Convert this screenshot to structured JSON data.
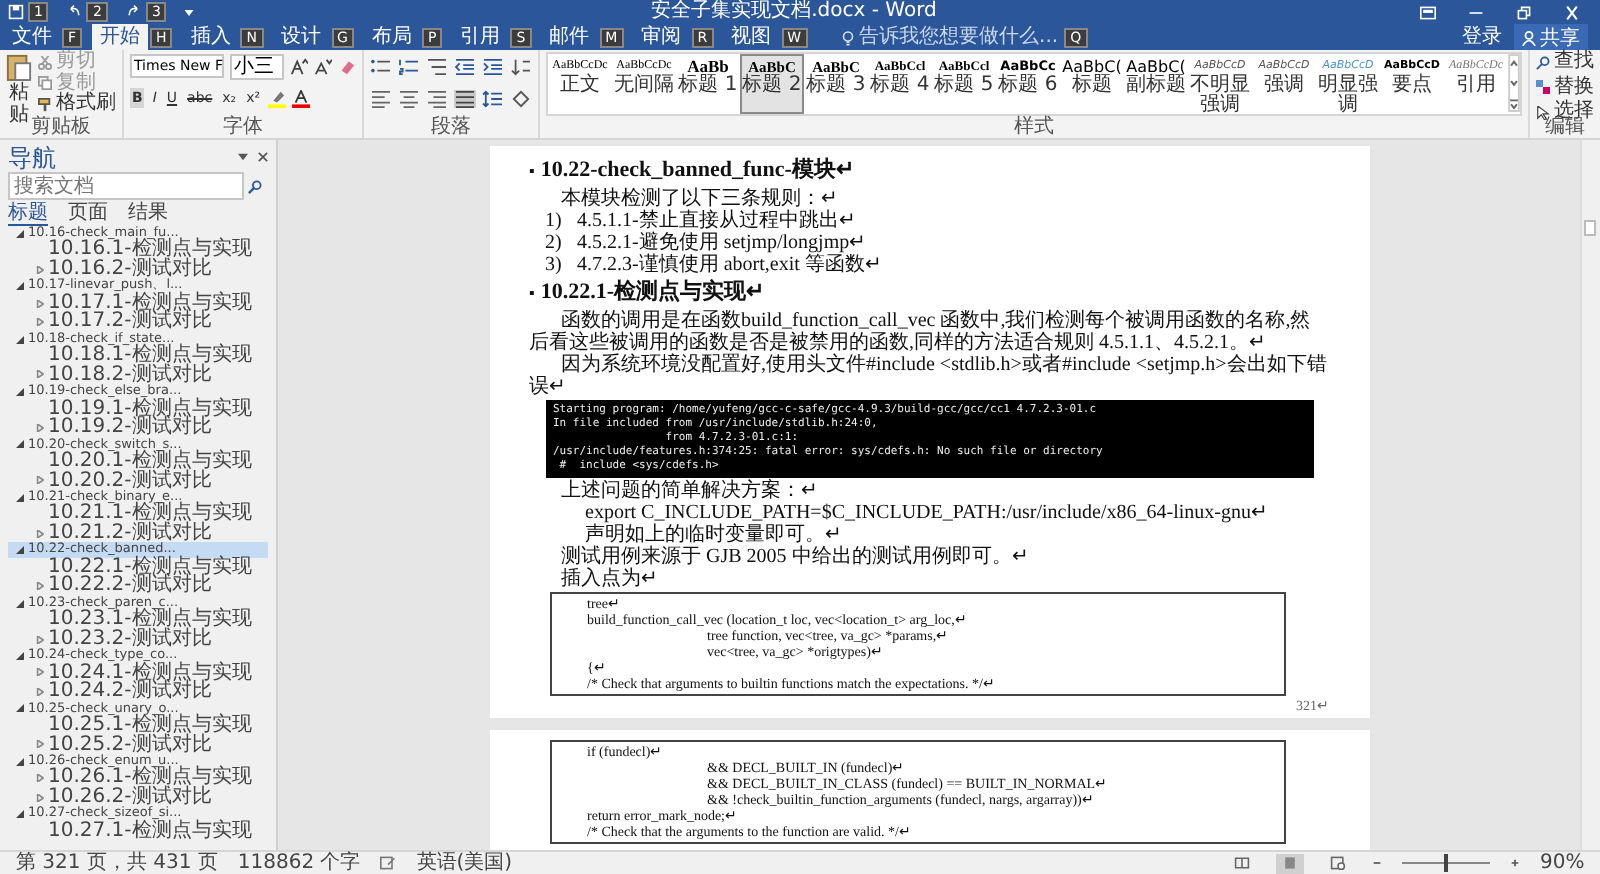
{
  "title_bar": {
    "title": "安全子集实现文档.docx - Word",
    "quick_access_keytips": [
      "1",
      "2",
      "3"
    ]
  },
  "ribbon_tabs": [
    {
      "label": "文件",
      "keytip": "F",
      "selected": false
    },
    {
      "label": "开始",
      "keytip": "H",
      "selected": true
    },
    {
      "label": "插入",
      "keytip": "N",
      "selected": false
    },
    {
      "label": "设计",
      "keytip": "G",
      "selected": false
    },
    {
      "label": "布局",
      "keytip": "P",
      "selected": false
    },
    {
      "label": "引用",
      "keytip": "S",
      "selected": false
    },
    {
      "label": "邮件",
      "keytip": "M",
      "selected": false
    },
    {
      "label": "审阅",
      "keytip": "R",
      "selected": false
    },
    {
      "label": "视图",
      "keytip": "W",
      "selected": false
    }
  ],
  "tell_me": {
    "placeholder": "告诉我您想要做什么...",
    "keytip": "Q"
  },
  "account": {
    "sign_in": "登录",
    "share": "共享"
  },
  "ribbon": {
    "clipboard": {
      "paste": "粘贴",
      "cut": "剪切",
      "copy": "复制",
      "format_painter": "格式刷",
      "label": "剪贴板"
    },
    "font": {
      "name": "Times New F",
      "size": "小三",
      "format_buttons": [
        "B",
        "I",
        "U",
        "abc",
        "x₂",
        "x²"
      ],
      "label": "字体"
    },
    "paragraph": {
      "label": "段落"
    },
    "styles": {
      "label": "样式",
      "items": [
        {
          "preview": "AaBbCcDc",
          "name": "正文",
          "selected": false
        },
        {
          "preview": "AaBbCcDc",
          "name": "无间隔",
          "selected": false
        },
        {
          "preview": "AaBb",
          "name": "标题 1",
          "selected": false
        },
        {
          "preview": "AaBbC",
          "name": "标题 2",
          "selected": true
        },
        {
          "preview": "AaBbC",
          "name": "标题 3",
          "selected": false
        },
        {
          "preview": "AaBbCcl",
          "name": "标题 4",
          "selected": false
        },
        {
          "preview": "AaBbCcl",
          "name": "标题 5",
          "selected": false
        },
        {
          "preview": "AaBbCc",
          "name": "标题 6",
          "selected": false
        },
        {
          "preview": "AaBbC(",
          "name": "标题",
          "selected": false
        },
        {
          "preview": "AaBbC(",
          "name": "副标题",
          "selected": false
        },
        {
          "preview": "AaBbCcD",
          "name": "不明显强调",
          "selected": false
        },
        {
          "preview": "AaBbCcD",
          "name": "强调",
          "selected": false
        },
        {
          "preview": "AaBbCcD",
          "name": "明显强调",
          "selected": false
        },
        {
          "preview": "AaBbCcD",
          "name": "要点",
          "selected": false
        },
        {
          "preview": "AaBbCcDc",
          "name": "引用",
          "selected": false
        }
      ]
    },
    "editing": {
      "find": "查找",
      "replace": "替换",
      "select": "选择",
      "label": "编辑"
    }
  },
  "navigation": {
    "title": "导航",
    "search": {
      "placeholder": "搜索文档"
    },
    "tabs": [
      {
        "label": "标题",
        "selected": true
      },
      {
        "label": "页面",
        "selected": false
      },
      {
        "label": "结果",
        "selected": false
      }
    ],
    "items": [
      {
        "label": "10.16-check_main_fu...",
        "expanded": true,
        "selected": false,
        "children": [
          {
            "label": "10.16.1-检测点与实现",
            "kind": "leaf"
          },
          {
            "label": "10.16.2-测试对比",
            "kind": "branch"
          }
        ]
      },
      {
        "label": "10.17-linevar_push、l...",
        "expanded": true,
        "selected": false,
        "children": [
          {
            "label": "10.17.1-检测点与实现",
            "kind": "branch"
          },
          {
            "label": "10.17.2-测试对比",
            "kind": "branch"
          }
        ]
      },
      {
        "label": "10.18-check_if_state...",
        "expanded": true,
        "selected": false,
        "children": [
          {
            "label": "10.18.1-检测点与实现",
            "kind": "leaf"
          },
          {
            "label": "10.18.2-测试对比",
            "kind": "branch"
          }
        ]
      },
      {
        "label": "10.19-check_else_bra...",
        "expanded": true,
        "selected": false,
        "children": [
          {
            "label": "10.19.1-检测点与实现",
            "kind": "leaf"
          },
          {
            "label": "10.19.2-测试对比",
            "kind": "branch"
          }
        ]
      },
      {
        "label": "10.20-check_switch_s...",
        "expanded": true,
        "selected": false,
        "children": [
          {
            "label": "10.20.1-检测点与实现",
            "kind": "leaf"
          },
          {
            "label": "10.20.2-测试对比",
            "kind": "branch"
          }
        ]
      },
      {
        "label": "10.21-check_binary_e...",
        "expanded": true,
        "selected": false,
        "children": [
          {
            "label": "10.21.1-检测点与实现",
            "kind": "leaf"
          },
          {
            "label": "10.21.2-测试对比",
            "kind": "branch"
          }
        ]
      },
      {
        "label": "10.22-check_banned...",
        "expanded": true,
        "selected": true,
        "children": [
          {
            "label": "10.22.1-检测点与实现",
            "kind": "leaf"
          },
          {
            "label": "10.22.2-测试对比",
            "kind": "branch"
          }
        ]
      },
      {
        "label": "10.23-check_paren_c...",
        "expanded": true,
        "selected": false,
        "children": [
          {
            "label": "10.23.1-检测点与实现",
            "kind": "leaf"
          },
          {
            "label": "10.23.2-测试对比",
            "kind": "branch"
          }
        ]
      },
      {
        "label": "10.24-check_type_co...",
        "expanded": true,
        "selected": false,
        "children": [
          {
            "label": "10.24.1-检测点与实现",
            "kind": "branch"
          },
          {
            "label": "10.24.2-测试对比",
            "kind": "branch"
          }
        ]
      },
      {
        "label": "10.25-check_unary_o...",
        "expanded": true,
        "selected": false,
        "children": [
          {
            "label": "10.25.1-检测点与实现",
            "kind": "leaf"
          },
          {
            "label": "10.25.2-测试对比",
            "kind": "branch"
          }
        ]
      },
      {
        "label": "10.26-check_enum_u...",
        "expanded": true,
        "selected": false,
        "children": [
          {
            "label": "10.26.1-检测点与实现",
            "kind": "branch"
          },
          {
            "label": "10.26.2-测试对比",
            "kind": "branch"
          }
        ]
      },
      {
        "label": "10.27-check_sizeof_si...",
        "expanded": true,
        "selected": false,
        "children": [
          {
            "label": "10.27.1-检测点与实现",
            "kind": "leaf"
          }
        ]
      }
    ]
  },
  "document": {
    "pages": [
      {
        "page_number": "321↵",
        "blocks": [
          {
            "kind": "heading",
            "bullet": "▪",
            "text": "10.22-check_banned_func-模块↵"
          },
          {
            "kind": "para",
            "text": "本模块检测了以下三条规则：↵"
          },
          {
            "kind": "list_item",
            "number": "1)",
            "text": "4.5.1.1-禁止直接从过程中跳出↵"
          },
          {
            "kind": "list_item",
            "number": "2)",
            "text": "4.5.2.1-避免使用 setjmp/longjmp↵"
          },
          {
            "kind": "list_item",
            "number": "3)",
            "text": "4.7.2.3-谨慎使用 abort,exit 等函数↵"
          },
          {
            "kind": "heading",
            "bullet": "▪",
            "text": "10.22.1-检测点与实现↵"
          },
          {
            "kind": "para",
            "text": "函数的调用是在函数build_function_call_vec 函数中,我们检测每个被调用函数的名称,然后看这些被调用的函数是否是被禁用的函数,同样的方法适合规则 4.5.1.1、4.5.2.1。↵"
          },
          {
            "kind": "para",
            "text": "因为系统环境没配置好,使用头文件#include <stdlib.h>或者#include <setjmp.h>会出如下错误↵"
          },
          {
            "kind": "terminal",
            "lines": [
              "Starting program: /home/yufeng/gcc-c-safe/gcc-4.9.3/build-gcc/gcc/cc1 4.7.2.3-01.c",
              "In file included from /usr/include/stdlib.h:24:0,",
              "                 from 4.7.2.3-01.c:1:",
              "/usr/include/features.h:374:25: fatal error: sys/cdefs.h: No such file or directory",
              " #  include <sys/cdefs.h>"
            ]
          },
          {
            "kind": "para",
            "text": "上述问题的简单解决方案：↵"
          },
          {
            "kind": "command",
            "text": "export C_INCLUDE_PATH=$C_INCLUDE_PATH:/usr/include/x86_64-linux-gnu↵"
          },
          {
            "kind": "command",
            "text": "声明如上的临时变量即可。↵"
          },
          {
            "kind": "para",
            "text": "测试用例来源于 GJB 2005 中给出的测试用例即可。↵"
          },
          {
            "kind": "para",
            "text": "插入点为↵"
          },
          {
            "kind": "code_box",
            "lines": [
              {
                "text": "tree↵",
                "indented": false
              },
              {
                "text": "build_function_call_vec (location_t loc, vec<location_t> arg_loc,↵",
                "indented": false
              },
              {
                "text": "tree function, vec<tree, va_gc> *params,↵",
                "indented": true
              },
              {
                "text": "vec<tree, va_gc> *origtypes)↵",
                "indented": true
              },
              {
                "text": "{↵",
                "indented": false
              },
              {
                "text": "/* Check that arguments to builtin functions match the expectations.    */↵",
                "indented": false
              }
            ]
          }
        ]
      },
      {
        "blocks": [
          {
            "kind": "code_box",
            "lines": [
              {
                "text": "if (fundecl)↵",
                "indented": false
              },
              {
                "text": "&& DECL_BUILT_IN (fundecl)↵",
                "indented": true
              },
              {
                "text": "&& DECL_BUILT_IN_CLASS (fundecl) == BUILT_IN_NORMAL↵",
                "indented": true
              },
              {
                "text": "&& !check_builtin_function_arguments (fundecl, nargs, argarray))↵",
                "indented": true
              },
              {
                "text": "return error_mark_node;↵",
                "indented": false
              },
              {
                "text": "/* Check that the arguments to the function are valid.    */↵",
                "indented": false
              }
            ]
          }
        ]
      }
    ]
  },
  "status_bar": {
    "page": "第 321 页，共 431 页",
    "words": "118862 个字",
    "language": "英语(美国)",
    "views": [
      {
        "kind": "read",
        "selected": false
      },
      {
        "kind": "print",
        "selected": true
      },
      {
        "kind": "web",
        "selected": false
      }
    ],
    "zoom": {
      "level": 0.5,
      "label": "90%"
    }
  }
}
